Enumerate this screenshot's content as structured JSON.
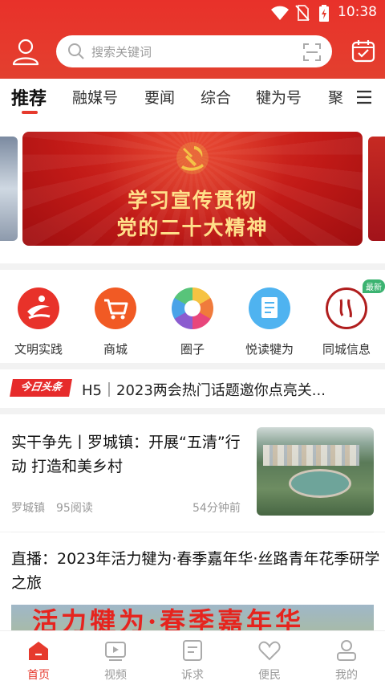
{
  "status_bar": {
    "time": "10:38"
  },
  "search": {
    "placeholder": "搜索关键词"
  },
  "tabs": [
    {
      "label": "推荐",
      "active": true
    },
    {
      "label": "融媒号"
    },
    {
      "label": "要闻"
    },
    {
      "label": "综合"
    },
    {
      "label": "犍为号"
    },
    {
      "label": "聚"
    }
  ],
  "banner": {
    "line1": "学习宣传贯彻",
    "line2": "党的二十大精神"
  },
  "quick_links": [
    {
      "label": "文明实践",
      "icon": "civilization-icon",
      "color": "#e8322a"
    },
    {
      "label": "商城",
      "icon": "cart-icon",
      "color": "#f15a24"
    },
    {
      "label": "圈子",
      "icon": "aperture-icon",
      "color": "#5bb8f0"
    },
    {
      "label": "悦读犍为",
      "icon": "document-icon",
      "color": "#4fb3f0"
    },
    {
      "label": "同城信息",
      "icon": "seal-icon",
      "color": "#b01e1e",
      "badge": "最新"
    }
  ],
  "headline": {
    "logo": "今日头条",
    "text": "H5｜2023两会热门话题邀你点亮关..."
  },
  "articles": [
    {
      "title": "实干争先丨罗城镇：开展“五清”行动 打造和美乡村",
      "source": "罗城镇",
      "views": "95阅读",
      "time": "54分钟前"
    },
    {
      "title": "直播：2023年活力犍为·春季嘉年华·丝路青年花季研学之旅",
      "image_text": "活力犍为·春季嘉年华"
    }
  ],
  "bottom_nav": [
    {
      "label": "首页",
      "icon": "home-icon",
      "active": true
    },
    {
      "label": "视频",
      "icon": "video-icon"
    },
    {
      "label": "诉求",
      "icon": "request-icon"
    },
    {
      "label": "便民",
      "icon": "heart-icon"
    },
    {
      "label": "我的",
      "icon": "profile-icon"
    }
  ],
  "colors": {
    "brand_red": "#e63a2d",
    "muted": "#999999"
  }
}
